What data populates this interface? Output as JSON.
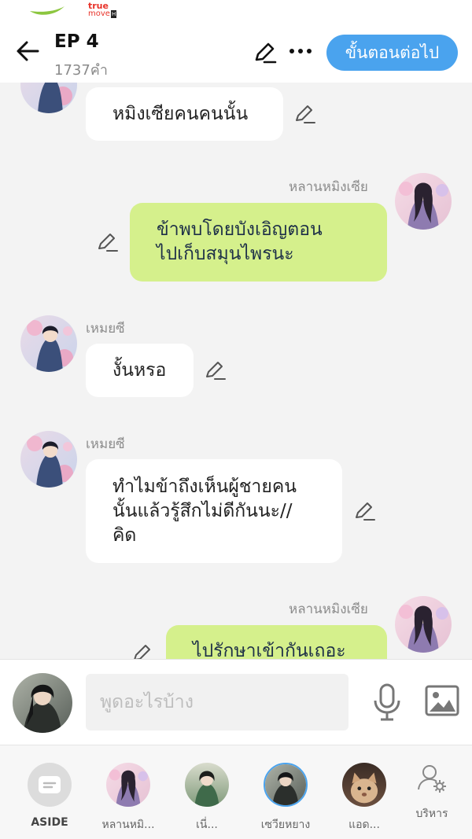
{
  "status_bar": {
    "carrier_brand": "true",
    "carrier_sub": "move",
    "carrier_badge": "H"
  },
  "header": {
    "title": "EP 4",
    "word_count": "1737คำ",
    "next_button": "ขั้นตอนต่อไป"
  },
  "messages": [
    {
      "side": "left",
      "sender": "",
      "lines": [
        "หมิงเซียคนคนนั้น"
      ]
    },
    {
      "side": "right",
      "sender": "หลานหมิงเซีย",
      "lines": [
        "ข้าพบโดยบังเอิญตอน",
        "ไปเก็บสมุนไพรนะ"
      ]
    },
    {
      "side": "left",
      "sender": "เหมยซี",
      "lines": [
        "งั้นหรอ"
      ]
    },
    {
      "side": "left",
      "sender": "เหมยซี",
      "lines": [
        "ทำไมข้าถึงเห็นผู้ชายคน",
        "นั้นแล้วรู้สึกไม่ดีกันนะ//",
        "คิด"
      ]
    },
    {
      "side": "right",
      "sender": "หลานหมิงเซีย",
      "lines": [
        "ไปรักษาเข้ากันเถอะ"
      ]
    }
  ],
  "composer": {
    "placeholder": "พูดอะไรบ้าง"
  },
  "characters": [
    {
      "label": "ASIDE",
      "icon": "aside-icon"
    },
    {
      "label": "หลานหมิ...",
      "icon": "avatar"
    },
    {
      "label": "เนี่...",
      "icon": "avatar"
    },
    {
      "label": "เซวียหยาง",
      "icon": "avatar",
      "selected": true
    },
    {
      "label": "แอด...",
      "icon": "avatar"
    },
    {
      "label": "บริหาร",
      "icon": "manage-users-icon"
    }
  ],
  "colors": {
    "accent": "#4aa3ee",
    "outgoing_bubble": "#d5f08c",
    "incoming_bubble": "#ffffff",
    "chat_background": "#f3f3f3"
  }
}
